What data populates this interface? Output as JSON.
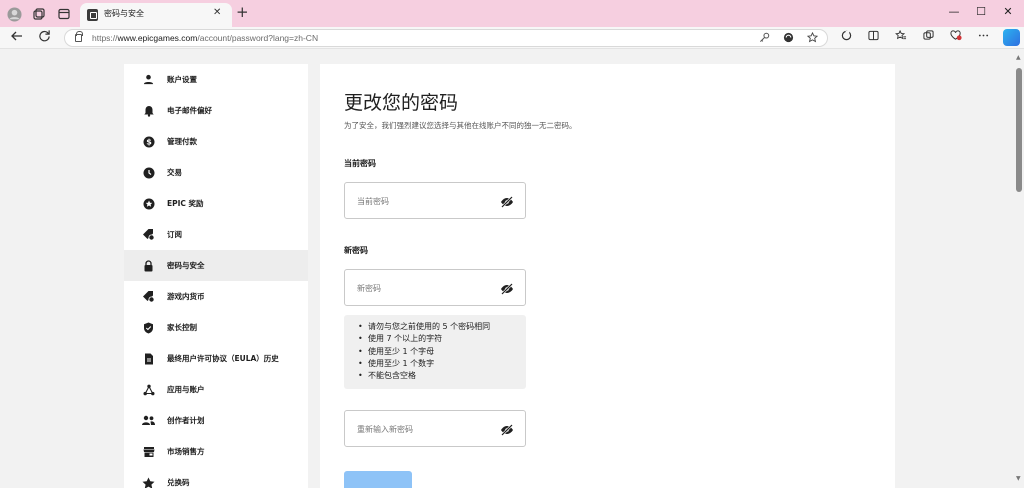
{
  "browser": {
    "tab_title": "密码与安全",
    "tab_close": "✕",
    "new_tab": "+",
    "url_prefix": "https://",
    "url_domain": "www.epicgames.com",
    "url_path": "/account/password?lang=zh-CN",
    "window_controls": {
      "minimize": "—",
      "maximize": "☐",
      "close": "✕"
    }
  },
  "sidebar": {
    "items": [
      {
        "label": "账户设置",
        "icon": "person-icon"
      },
      {
        "label": "电子邮件偏好",
        "icon": "bell-icon"
      },
      {
        "label": "管理付款",
        "icon": "dollar-icon"
      },
      {
        "label": "交易",
        "icon": "clock-icon"
      },
      {
        "label": "EPIC 奖励",
        "icon": "star-badge-icon"
      },
      {
        "label": "订阅",
        "icon": "tag-icon"
      },
      {
        "label": "密码与安全",
        "icon": "lock-icon",
        "active": true
      },
      {
        "label": "游戏内货币",
        "icon": "coin-tag-icon"
      },
      {
        "label": "家长控制",
        "icon": "shield-icon"
      },
      {
        "label": "最终用户许可协议（EULA）历史",
        "icon": "document-icon"
      },
      {
        "label": "应用与账户",
        "icon": "nodes-icon"
      },
      {
        "label": "创作者计划",
        "icon": "people-icon"
      },
      {
        "label": "市场销售方",
        "icon": "store-icon"
      },
      {
        "label": "兑换码",
        "icon": "star-icon"
      }
    ]
  },
  "main": {
    "title": "更改您的密码",
    "subtitle": "为了安全，我们强烈建议您选择与其他在线账户不同的独一无二密码。",
    "current_section": "当前密码",
    "current_placeholder": "当前密码",
    "new_section": "新密码",
    "new_placeholder": "新密码",
    "rules": [
      "请勿与您之前使用的 5 个密码相同",
      "使用 7 个以上的字符",
      "使用至少 1 个字母",
      "使用至少 1 个数字",
      "不能包含空格"
    ],
    "confirm_placeholder": "重新输入新密码"
  },
  "colors": {
    "titlebar": "#f6cfe0",
    "button": "#8ec3f7",
    "active_item": "#ededed"
  }
}
